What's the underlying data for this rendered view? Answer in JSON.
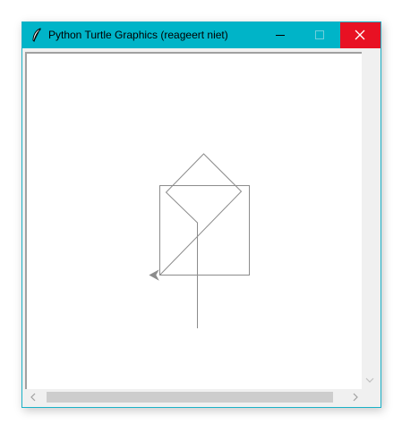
{
  "window": {
    "title": "Python Turtle Graphics (reageert niet)",
    "app_icon": "feather-icon",
    "controls": {
      "minimize_icon": "minimize-icon",
      "maximize_icon": "maximize-icon",
      "close_icon": "close-icon"
    }
  },
  "scrollbars": {
    "left_arrow_icon": "chevron-left-icon",
    "right_arrow_icon": "chevron-right-icon",
    "down_arrow_icon": "chevron-down-icon"
  },
  "colors": {
    "titlebar": "#00b4c8",
    "close_button": "#e81123",
    "drawing_stroke": "#8c8c8c"
  }
}
